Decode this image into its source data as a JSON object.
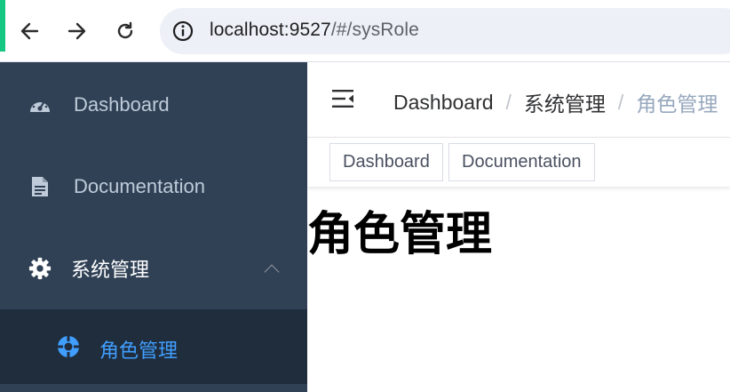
{
  "browser": {
    "url_host": "localhost:9527",
    "url_path": "/#/sysRole"
  },
  "sidebar": {
    "items": [
      {
        "label": "Dashboard",
        "icon": "dashboard-icon"
      },
      {
        "label": "Documentation",
        "icon": "document-icon"
      },
      {
        "label": "系统管理",
        "icon": "gear-icon",
        "expanded": true
      }
    ],
    "submenu": [
      {
        "label": "角色管理",
        "icon": "role-icon",
        "active": true
      }
    ]
  },
  "navbar": {
    "breadcrumb": [
      "Dashboard",
      "系统管理",
      "角色管理"
    ],
    "separator": "/"
  },
  "tags": [
    "Dashboard",
    "Documentation"
  ],
  "page": {
    "title": "角色管理"
  },
  "colors": {
    "sidebar_bg": "#304156",
    "submenu_bg": "#1f2d3d",
    "sidebar_text": "#bfcbd9",
    "active_text": "#409eff",
    "breadcrumb_current": "#97a8be",
    "browser_accent": "#16c784"
  }
}
